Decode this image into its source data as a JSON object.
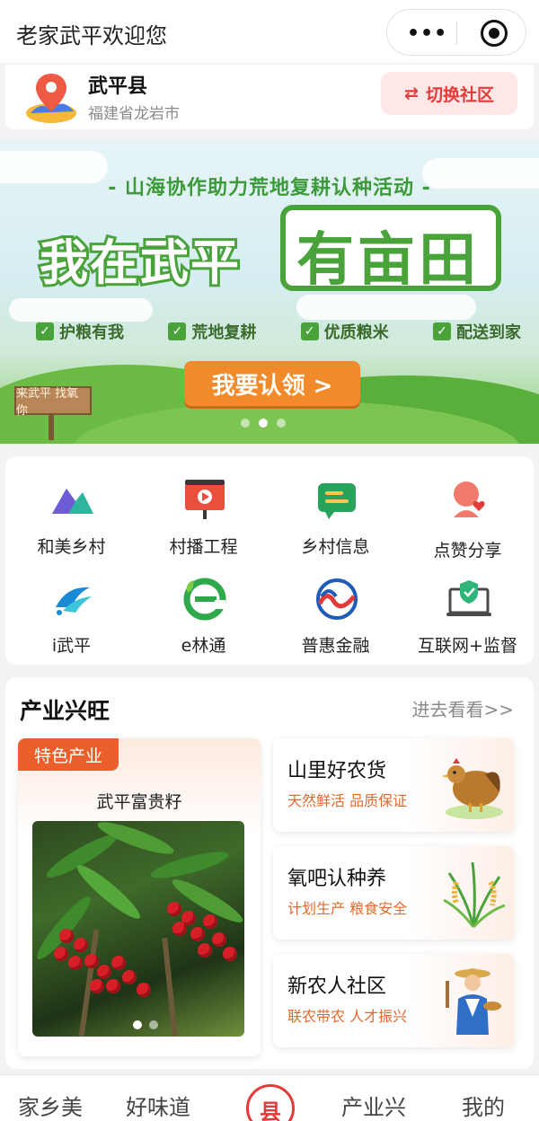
{
  "navbar": {
    "title": "老家武平欢迎您",
    "more_icon": "more-dots-icon",
    "close_icon": "target-icon"
  },
  "location": {
    "name": "武平县",
    "region": "福建省龙岩市",
    "switch_label": "切换社区",
    "switch_icon": "⇄"
  },
  "banner": {
    "subtitle": "- 山海协作助力荒地复耕认种活动 -",
    "title_part1": "我在武平",
    "title_part2": "有亩田",
    "checks": [
      "护粮有我",
      "荒地复耕",
      "优质粮米",
      "配送到家"
    ],
    "cta": "我要认领 >",
    "sign": "来武平 找氧你",
    "slide_count": 3,
    "active_slide": 1
  },
  "grid": [
    {
      "label": "和美乡村",
      "icon": "mountain-icon"
    },
    {
      "label": "村播工程",
      "icon": "video-board-icon"
    },
    {
      "label": "乡村信息",
      "icon": "message-icon"
    },
    {
      "label": "点赞分享",
      "icon": "like-share-icon"
    },
    {
      "label": "i武平",
      "icon": "i-wuping-logo-icon"
    },
    {
      "label": "e林通",
      "icon": "e-lintong-logo-icon"
    },
    {
      "label": "普惠金融",
      "icon": "finance-logo-icon"
    },
    {
      "label": "互联网+监督",
      "icon": "shield-laptop-icon"
    }
  ],
  "industry": {
    "title": "产业兴旺",
    "more": "进去看看>>",
    "feature": {
      "tag": "特色产业",
      "name": "武平富贵籽",
      "image": "red-berry-plant-photo"
    },
    "cards": [
      {
        "title": "山里好农货",
        "subtitle": "天然鲜活 品质保证",
        "icon": "hen-icon"
      },
      {
        "title": "氧吧认种养",
        "subtitle": "计划生产 粮食安全",
        "icon": "rice-plant-icon"
      },
      {
        "title": "新农人社区",
        "subtitle": "联农带农 人才振兴",
        "icon": "farmer-icon"
      }
    ]
  },
  "tabbar": {
    "items": [
      "家乡美",
      "好味道",
      "县",
      "产业兴",
      "我的"
    ],
    "active": "县"
  },
  "colors": {
    "accent": "#e23b3b",
    "green": "#4aa23b",
    "orange": "#ea5f2c"
  }
}
